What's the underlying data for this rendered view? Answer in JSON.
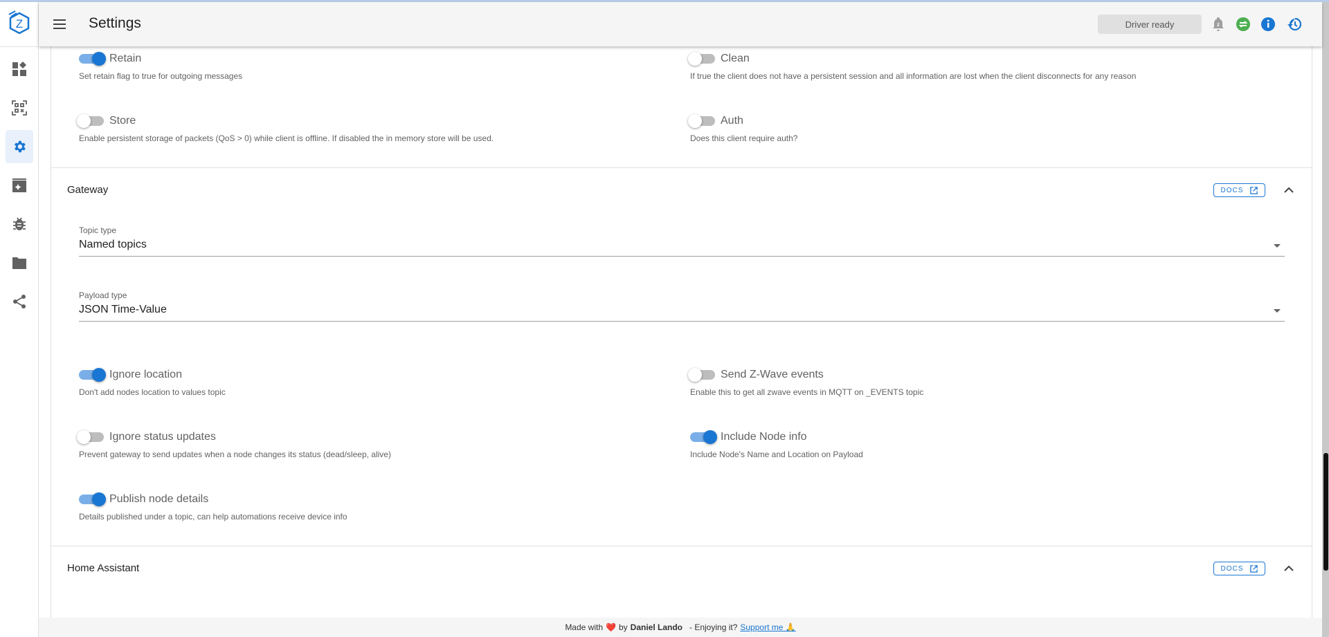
{
  "header": {
    "title": "Settings",
    "driver_status": "Driver ready"
  },
  "colors": {
    "accent": "#1976d2",
    "success": "#4caf50",
    "switch_on": "#1976d2"
  },
  "sidebar": {
    "items": [
      {
        "icon": "dashboard-icon"
      },
      {
        "icon": "qr-code-scan-icon"
      },
      {
        "icon": "settings-gear-icon",
        "active": true
      },
      {
        "icon": "scenes-icon"
      },
      {
        "icon": "debug-bug-icon"
      },
      {
        "icon": "folder-icon"
      },
      {
        "icon": "share-network-icon"
      }
    ]
  },
  "mqtt": {
    "switches": [
      {
        "label": "Retain",
        "desc": "Set retain flag to true for outgoing messages",
        "on": true
      },
      {
        "label": "Clean",
        "desc": "If true the client does not have a persistent session and all information are lost when the client disconnects for any reason",
        "on": false
      },
      {
        "label": "Store",
        "desc": "Enable persistent storage of packets (QoS > 0) while client is offline. If disabled the in memory store will be used.",
        "on": false
      },
      {
        "label": "Auth",
        "desc": "Does this client require auth?",
        "on": false
      }
    ]
  },
  "gateway": {
    "title": "Gateway",
    "docs_label": "DOCS",
    "topic_type": {
      "label": "Topic type",
      "value": "Named topics"
    },
    "payload_type": {
      "label": "Payload type",
      "value": "JSON Time-Value"
    },
    "switches": [
      {
        "label": "Ignore location",
        "desc": "Don't add nodes location to values topic",
        "on": true
      },
      {
        "label": "Send Z-Wave events",
        "desc": "Enable this to get all zwave events in MQTT on _EVENTS topic",
        "on": false
      },
      {
        "label": "Ignore status updates",
        "desc": "Prevent gateway to send updates when a node changes its status (dead/sleep, alive)",
        "on": false
      },
      {
        "label": "Include Node info",
        "desc": "Include Node's Name and Location on Payload",
        "on": true
      },
      {
        "label": "Publish node details",
        "desc": "Details published under a topic, can help automations receive device info",
        "on": true
      }
    ]
  },
  "home_assistant": {
    "title": "Home Assistant",
    "docs_label": "DOCS"
  },
  "footer": {
    "made_with": "Made with",
    "heart": "❤️",
    "by": "by",
    "author": "Daniel Lando",
    "enjoying": "- Enjoying it?",
    "support": "Support me 🙏"
  }
}
